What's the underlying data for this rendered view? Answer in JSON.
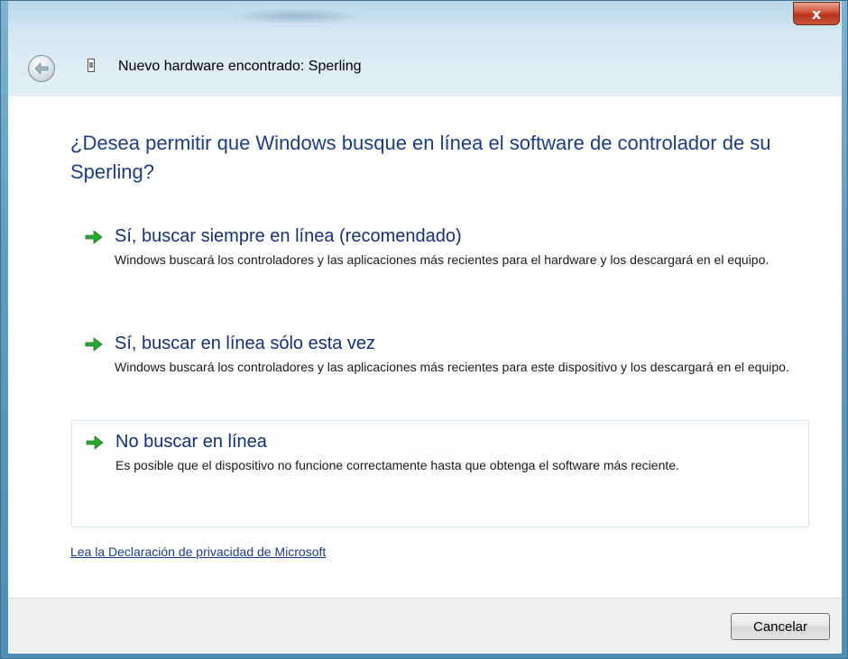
{
  "window": {
    "title": "Nuevo hardware encontrado: Sperling",
    "close_label": "x"
  },
  "question": "¿Desea permitir que Windows busque en línea el software de controlador de su Sperling?",
  "options": [
    {
      "title": "Sí, buscar siempre en línea (recomendado)",
      "description": "Windows buscará los controladores y las aplicaciones más recientes para el hardware y los descargará en el equipo."
    },
    {
      "title": "Sí, buscar en línea sólo esta vez",
      "description": "Windows buscará los controladores y las aplicaciones más recientes para este dispositivo y los descargará en el equipo."
    },
    {
      "title": "No buscar en línea",
      "description": "Es posible que el dispositivo no funcione correctamente hasta que obtenga el software más reciente."
    }
  ],
  "privacy_link": "Lea la Declaración de privacidad de Microsoft",
  "footer": {
    "cancel_label": "Cancelar"
  },
  "colors": {
    "heading": "#1b3c88",
    "arrow": "#2aa832",
    "close": "#c9523a"
  }
}
